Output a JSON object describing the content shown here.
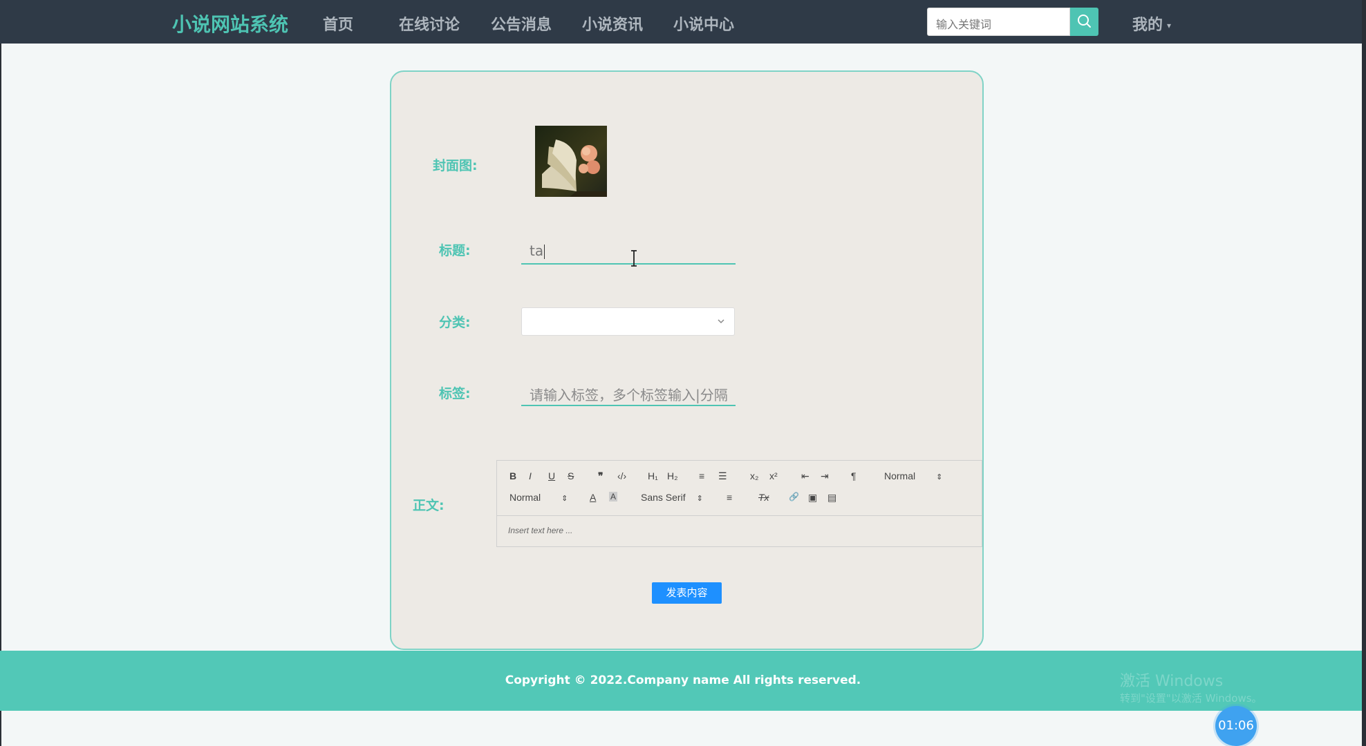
{
  "header": {
    "brand": "小说网站系统",
    "nav": [
      "首页",
      "在线讨论",
      "公告消息",
      "小说资讯",
      "小说中心"
    ],
    "search_placeholder": "输入关键词",
    "user_menu": "我的"
  },
  "form": {
    "cover_label": "封面图:",
    "title_label": "标题:",
    "title_value": "ta",
    "category_label": "分类:",
    "category_value": "",
    "tags_label": "标签:",
    "tags_placeholder": "请输入标签，多个标签输入|分隔",
    "body_label": "正文:",
    "editor": {
      "row1": {
        "bold": "B",
        "italic": "I",
        "underline": "U",
        "strike": "S",
        "quote": "❞",
        "code": "‹/›",
        "h1": "H₁",
        "h2": "H₂",
        "ordered_list": "≡",
        "bullet_list": "☰",
        "subscript": "x₂",
        "superscript": "x²",
        "outdent": "⇤",
        "indent": "⇥",
        "direction": "¶",
        "header_select": "Normal"
      },
      "row2": {
        "size_select": "Normal",
        "color": "A",
        "background": "A",
        "font_select": "Sans Serif",
        "align": "≡",
        "clean": "Tx",
        "link": "🔗",
        "image": "▣",
        "video": "▤"
      },
      "body_placeholder": "Insert text here ..."
    },
    "publish": "发表内容"
  },
  "footer": {
    "copyright": "Copyright © 2022.Company name All rights reserved.",
    "watermark_line1": "激活 Windows",
    "watermark_line2": "转到\"设置\"以激活 Windows。"
  },
  "timer": "01:06",
  "colors": {
    "accent": "#4ec4b3",
    "topbar": "#2f3a47",
    "card": "#edeae5",
    "publish": "#1e90ff",
    "footer": "#52c8b7"
  }
}
